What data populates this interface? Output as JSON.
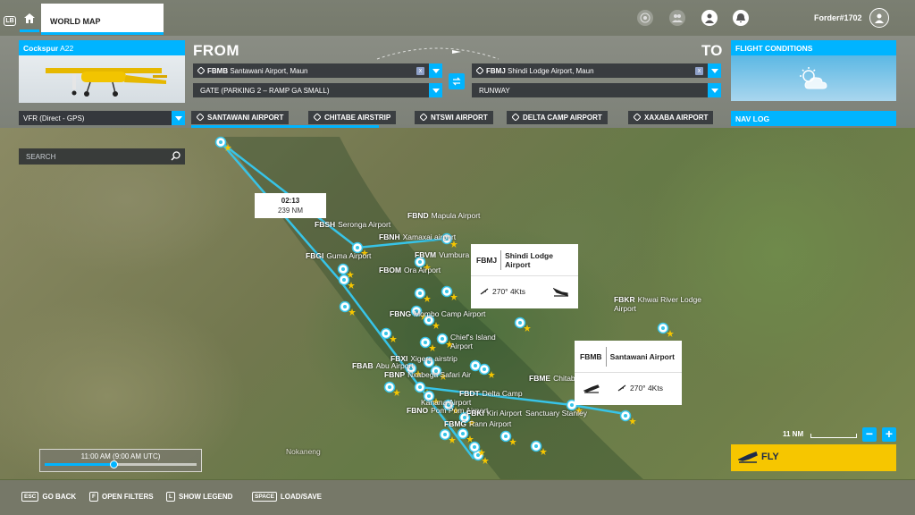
{
  "header": {
    "lb_badge": "LB",
    "tab_label": "WORLD MAP",
    "username": "Forder#1702"
  },
  "aircraft": {
    "name_bold": "Cockspur",
    "name_rest": "A22"
  },
  "route": {
    "from_label": "FROM",
    "to_label": "TO",
    "departure": {
      "code": "FBMB",
      "name": "Santawani Airport, Maun",
      "clear": "x"
    },
    "arrival": {
      "code": "FBMJ",
      "name": "Shindi Lodge Airport, Maun",
      "clear": "x"
    },
    "departure_gate": "GATE (PARKING 2 – RAMP GA SMALL)",
    "arrival_gate": "RUNWAY"
  },
  "conditions": {
    "title": "FLIGHT CONDITIONS"
  },
  "flight_plan": {
    "type": "VFR (Direct - GPS)",
    "waypoints": [
      "SANTAWANI AIRPORT",
      "CHITABE AIRSTRIP",
      "NTSWI AIRPORT",
      "DELTA CAMP AIRPORT",
      "XAXABA AIRPORT"
    ],
    "navlog_label": "NAV LOG"
  },
  "search": {
    "placeholder": "SEARCH"
  },
  "leg_info": {
    "time": "02:13",
    "distance": "239 NM"
  },
  "map_labels": [
    {
      "code": "FBSH",
      "name": "Seronga Airport"
    },
    {
      "code": "FBND",
      "name": "Mapula Airport"
    },
    {
      "code": "FBNH",
      "name": "Xamaxai airport"
    },
    {
      "code": "FBVM",
      "name": "Vumbura"
    },
    {
      "code": "FBGI",
      "name": "Guma Airport"
    },
    {
      "code": "FBOM",
      "name": "Ora Airport"
    },
    {
      "code": "FBNG",
      "name": "Mombo Camp Airport"
    },
    {
      "code": "",
      "name": "Chief's Island Airport"
    },
    {
      "code": "FBXI",
      "name": "Xigera airstrip"
    },
    {
      "code": "FBAB",
      "name": "Abu Airport"
    },
    {
      "code": "FBNP",
      "name": "Nxabega Safari Air"
    },
    {
      "code": "FBKR",
      "name": "Khwai River Lodge Airport"
    },
    {
      "code": "FBME",
      "name": "Chitabe"
    },
    {
      "code": "",
      "name": "Kanana Airport"
    },
    {
      "code": "FBDT",
      "name": "Delta Camp"
    },
    {
      "code": "FBNO",
      "name": "Pom Pom Airport"
    },
    {
      "code": "FBMG",
      "name": "Rann Airport"
    },
    {
      "code": "FBKI",
      "name": "Kiri Airport"
    },
    {
      "code": "",
      "name": "Sanctuary Stanley"
    },
    {
      "code": "",
      "name": "Nokaneng"
    }
  ],
  "arrival_card": {
    "code": "FBMJ",
    "name": "Shindi Lodge Airport",
    "wind": "270° 4Kts"
  },
  "departure_card": {
    "code": "FBMB",
    "name": "Santawani Airport",
    "wind": "270° 4Kts"
  },
  "time_slider": {
    "label": "11:00 AM (9:00 AM UTC)",
    "progress": 0.45
  },
  "scale": {
    "label": "11 NM"
  },
  "zoom": {
    "out": "−",
    "in": "+"
  },
  "fly_button": {
    "label": "FLY"
  },
  "footer": {
    "hints": [
      {
        "key": "ESC",
        "label": "GO BACK"
      },
      {
        "key": "F",
        "label": "OPEN FILTERS"
      },
      {
        "key": "L",
        "label": "SHOW LEGEND"
      },
      {
        "key": "SPACE",
        "label": "LOAD/SAVE"
      }
    ]
  },
  "colors": {
    "accent": "#00b4ff",
    "fly": "#f6c600",
    "route": "#37c4e8"
  }
}
